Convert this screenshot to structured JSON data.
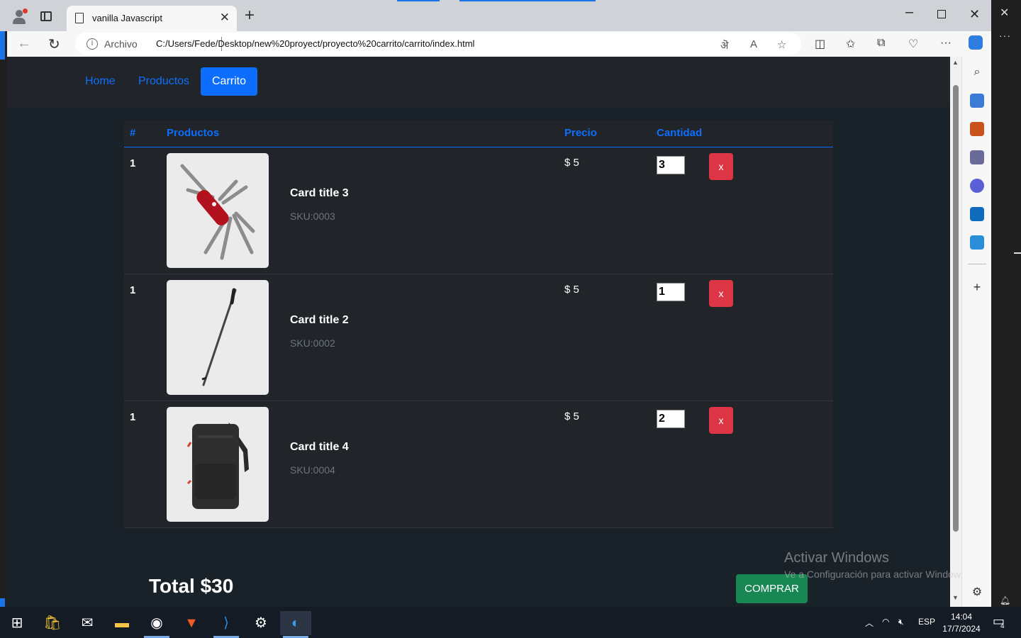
{
  "browser": {
    "tab_title": "vanilla Javascript",
    "address_scheme": "Archivo",
    "address_url": "C:/Users/Fede/Desktop/new%20proyect/proyecto%20carrito/carrito/index.html"
  },
  "nav": {
    "items": [
      {
        "label": "Home",
        "active": false
      },
      {
        "label": "Productos",
        "active": false
      },
      {
        "label": "Carrito",
        "active": true
      }
    ]
  },
  "table": {
    "headers": {
      "index": "#",
      "product": "Productos",
      "price": "Precio",
      "quantity": "Cantidad"
    },
    "rows": [
      {
        "index": "1",
        "name": "Card title 3",
        "sku": "SKU:0003",
        "price": "$ 5",
        "quantity": "3",
        "remove": "x",
        "image": "pocket-knife"
      },
      {
        "index": "1",
        "name": "Card title 2",
        "sku": "SKU:0002",
        "price": "$ 5",
        "quantity": "1",
        "remove": "x",
        "image": "trekking-pole"
      },
      {
        "index": "1",
        "name": "Card title 4",
        "sku": "SKU:0004",
        "price": "$ 5",
        "quantity": "2",
        "remove": "x",
        "image": "backpack"
      }
    ]
  },
  "cart": {
    "total": "Total $30",
    "buy_label": "COMPRAR"
  },
  "watermark": {
    "line1": "Activar Windows",
    "line2": "Ve a Configuración para activar Windows."
  },
  "taskbar": {
    "language": "ESP",
    "time": "14:04",
    "date": "17/7/2024",
    "notifications": "4"
  },
  "colors": {
    "primary": "#0d6efd",
    "danger": "#dc3545",
    "success": "#198754",
    "page_bg": "#192129",
    "table_bg": "#212529"
  }
}
